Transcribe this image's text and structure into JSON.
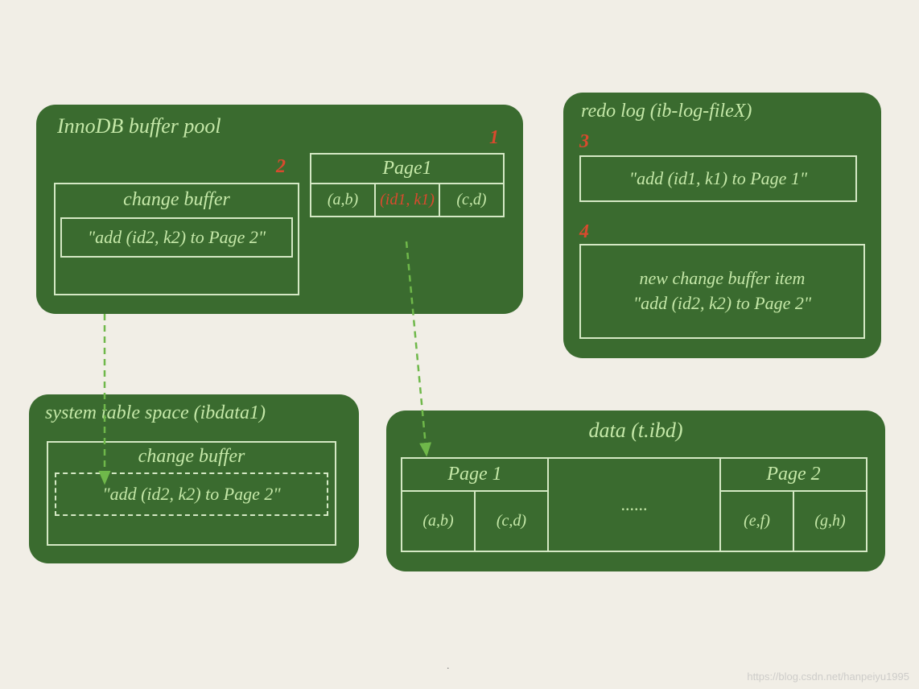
{
  "bufferpool": {
    "title": "InnoDB buffer pool",
    "num1": "1",
    "num2": "2",
    "changebuffer": {
      "label": "change buffer",
      "entry": "\"add (id2, k2) to Page 2\""
    },
    "page1": {
      "header": "Page1",
      "cells": [
        "(a,b)",
        "(id1, k1)",
        "(c,d)"
      ]
    }
  },
  "redolog": {
    "title": "redo log (ib-log-fileX)",
    "num3": "3",
    "num4": "4",
    "entry1": "\"add (id1, k1) to Page 1\"",
    "entry2_line1": "new change buffer item",
    "entry2_line2": "\"add (id2, k2) to Page 2\""
  },
  "systs": {
    "title": "system table space (ibdata1)",
    "changebuffer": {
      "label": "change buffer",
      "entry": "\"add (id2, k2) to Page 2\""
    }
  },
  "data": {
    "title": "data (t.ibd)",
    "page1": {
      "header": "Page 1",
      "cells": [
        "(a,b)",
        "(c,d)"
      ]
    },
    "gap": "......",
    "page2": {
      "header": "Page 2",
      "cells": [
        "(e,f)",
        "(g,h)"
      ]
    }
  },
  "watermark": "https://blog.csdn.net/hanpeiyu1995"
}
